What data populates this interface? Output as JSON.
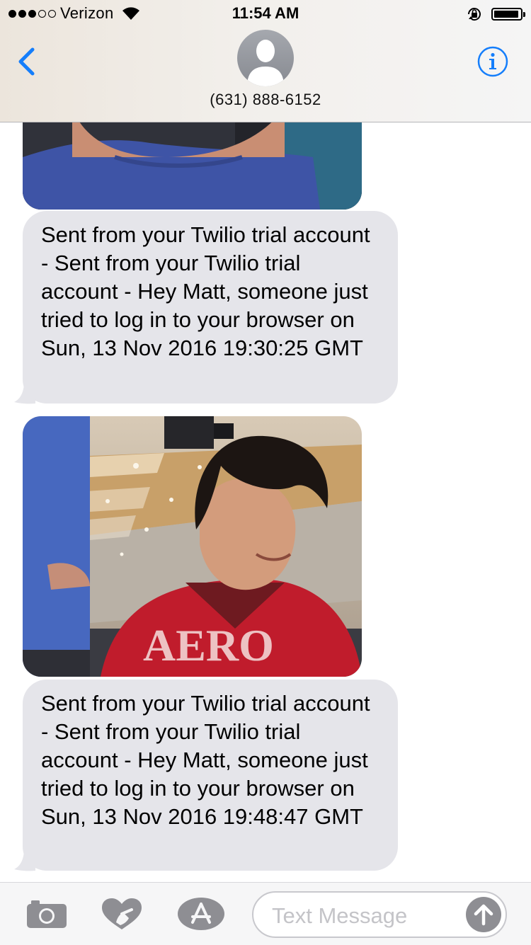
{
  "status_bar": {
    "carrier": "Verizon",
    "signal_bars_filled": 3,
    "signal_bars_total": 5,
    "time": "11:54 AM",
    "battery_level": 0.95
  },
  "nav": {
    "contact_number": "(631) 888-6152",
    "back_icon": "chevron-left-icon",
    "info_icon": "info-icon"
  },
  "messages": [
    {
      "type": "image",
      "description_icon": "photo"
    },
    {
      "type": "text",
      "text": "Sent from your Twilio trial account - Sent from your Twilio trial account - Hey Matt, someone just tried to log in to your browser on Sun, 13 Nov 2016 19:30:25 GMT"
    },
    {
      "type": "image",
      "description_icon": "photo"
    },
    {
      "type": "text",
      "text": "Sent from your Twilio trial account - Sent from your Twilio trial account - Hey Matt, someone just tried to log in to your browser on Sun, 13 Nov 2016 19:48:47 GMT"
    }
  ],
  "input_bar": {
    "placeholder": "Text Message",
    "value": "",
    "camera_icon": "camera-icon",
    "digital_touch_icon": "heart-hand-icon",
    "apps_icon": "app-store-icon",
    "send_icon": "arrow-up-icon"
  },
  "colors": {
    "accent": "#157efb",
    "bubble_gray": "#e5e5ea",
    "icon_gray": "#8e8e93"
  }
}
